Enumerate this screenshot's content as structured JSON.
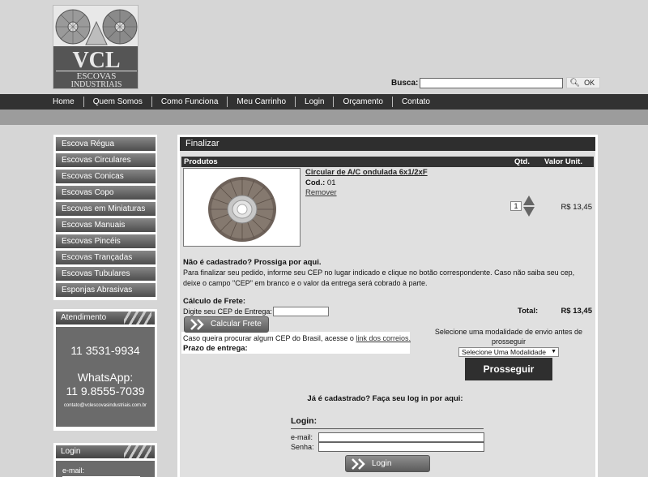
{
  "logo": {
    "line1": "VCL",
    "line2": "ESCOVAS",
    "line3": "INDUSTRIAIS"
  },
  "search": {
    "label": "Busca:",
    "value": "",
    "button_label": "OK"
  },
  "nav": [
    "Home",
    "Quem Somos",
    "Como Funciona",
    "Meu Carrinho",
    "Login",
    "Orçamento",
    "Contato"
  ],
  "sidebar": {
    "categories": [
      "Escova Régua",
      "Escovas Circulares",
      "Escovas Conicas",
      "Escovas Copo",
      "Escovas em Miniaturas",
      "Escovas Manuais",
      "Escovas Pincéis",
      "Escovas Trançadas",
      "Escovas Tubulares",
      "Esponjas Abrasivas"
    ],
    "atendimento": {
      "title": "Atendimento",
      "phone": "11 3531-9934",
      "whatsapp_label": "WhatsApp:",
      "whatsapp_number": "11 9.8555-7039",
      "email": "contato@vclescovasindustriais.com.br"
    },
    "login": {
      "title": "Login",
      "email_label": "e-mail:"
    }
  },
  "main": {
    "title": "Finalizar",
    "table": {
      "headers": {
        "produtos": "Produtos",
        "qtd": "Qtd.",
        "valor": "Valor Unit."
      },
      "product": {
        "name": "Circular de A/C ondulada 6x1/2xF",
        "code_label": "Cod.:",
        "code": "01",
        "remove_label": "Remover",
        "quantity": "1",
        "unit_price": "R$ 13,45"
      }
    },
    "not_registered_title": "Não é cadastrado? Prossiga por aqui.",
    "not_registered_text": "Para finalizar seu pedido, informe seu CEP no lugar indicado e clique no botão correspondente. Caso não saiba seu cep, deixe o campo \"CEP\" em branco e o valor da entrega será cobrado à parte.",
    "frete": {
      "title": "Cálculo de Frete:",
      "cep_label": "Digite seu CEP de Entrega:",
      "cep_value": "",
      "calc_button": "Calcular Frete",
      "search_text": "Caso queira procurar algum CEP do Brasil, acesse o",
      "search_link": "link dos correios.",
      "prazo_label": "Prazo de entrega:"
    },
    "total_label": "Total:",
    "total_value": "R$ 13,45",
    "shipping_prompt": "Selecione uma modalidade de envio antes de prosseguir",
    "shipping_select": "Selecione Uma Modalidade",
    "prosseguir": "Prosseguir",
    "already_registered": "Já é cadastrado? Faça seu log in por aqui:",
    "login": {
      "title": "Login:",
      "email_label": "e-mail:",
      "senha_label": "Senha:",
      "email_value": "",
      "senha_value": "",
      "button": "Login"
    }
  }
}
